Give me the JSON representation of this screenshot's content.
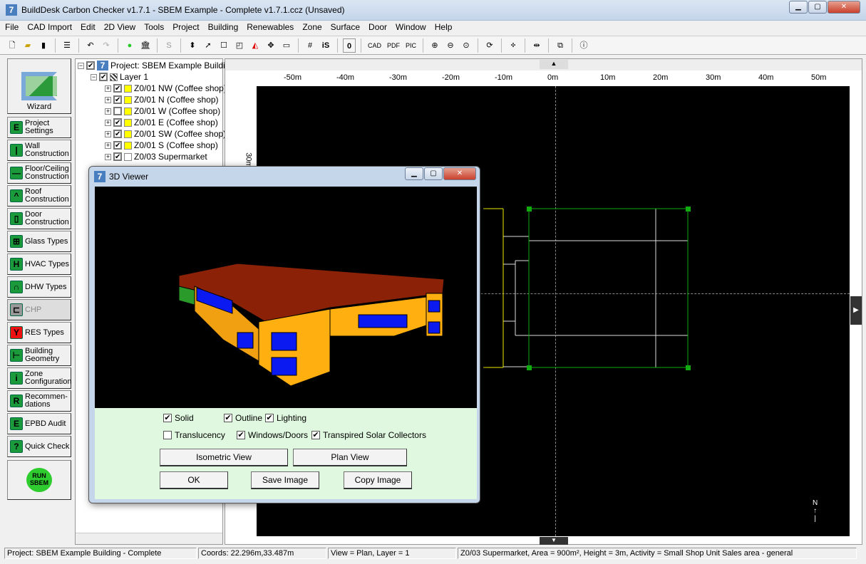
{
  "window": {
    "title": "BuildDesk Carbon Checker v1.7.1 - SBEM Example - Complete v1.7.1.ccz (Unsaved)",
    "app_icon": "7"
  },
  "menu": [
    "File",
    "CAD Import",
    "Edit",
    "2D View",
    "Tools",
    "Project",
    "Building",
    "Renewables",
    "Zone",
    "Surface",
    "Door",
    "Window",
    "Help"
  ],
  "toolbar": {
    "text_buttons": [
      "S",
      "iS",
      "0",
      "CAD",
      "PDF",
      "PIC"
    ]
  },
  "sidebar": {
    "wizard_label": "Wizard",
    "items": [
      {
        "label": "Project Settings",
        "icon": "E",
        "color": "#1a9a3a"
      },
      {
        "label": "Wall Construction",
        "icon": "|",
        "color": "#1a9a3a"
      },
      {
        "label": "Floor/Ceiling Construction",
        "icon": "—",
        "color": "#1a9a3a"
      },
      {
        "label": "Roof Construction",
        "icon": "^",
        "color": "#1a9a3a"
      },
      {
        "label": "Door Construction",
        "icon": "▯",
        "color": "#1a9a3a"
      },
      {
        "label": "Glass Types",
        "icon": "⊞",
        "color": "#1a9a3a"
      },
      {
        "label": "HVAC Types",
        "icon": "H",
        "color": "#1a9a3a"
      },
      {
        "label": "DHW Types",
        "icon": "∩",
        "color": "#1a9a3a"
      },
      {
        "label": "CHP",
        "icon": "⊏",
        "color": "#999999",
        "disabled": true
      },
      {
        "label": "RES Types",
        "icon": "Y",
        "color": "#ee1111"
      },
      {
        "label": "Building Geometry",
        "icon": "⊢",
        "color": "#1a9a3a"
      },
      {
        "label": "Zone Configuration",
        "icon": "i",
        "color": "#1a9a3a"
      },
      {
        "label": "Recommen-dations",
        "icon": "R",
        "color": "#1a9a3a"
      },
      {
        "label": "EPBD Audit",
        "icon": "E",
        "color": "#1a9a3a"
      },
      {
        "label": "Quick Check",
        "icon": "?",
        "color": "#1a9a3a"
      }
    ],
    "run_label": "RUN SBEM"
  },
  "tree": {
    "project": "Project: SBEM Example Building",
    "layer": "Layer 1",
    "zones": [
      {
        "label": "Z0/01 NW (Coffee shop)",
        "checked": true,
        "color": "#ffff00"
      },
      {
        "label": "Z0/01 N (Coffee shop)",
        "checked": true,
        "color": "#ffff00"
      },
      {
        "label": "Z0/01 W (Coffee shop)",
        "checked": false,
        "color": "#ffff00"
      },
      {
        "label": "Z0/01 E (Coffee shop)",
        "checked": true,
        "color": "#ffff00"
      },
      {
        "label": "Z0/01 SW (Coffee shop)",
        "checked": true,
        "color": "#ffff00"
      },
      {
        "label": "Z0/01 S (Coffee shop)",
        "checked": true,
        "color": "#ffff00"
      },
      {
        "label": "Z0/03 Supermarket",
        "checked": true,
        "color": "#ffffff"
      }
    ]
  },
  "ruler": {
    "x_labels": [
      "-50m",
      "-40m",
      "-30m",
      "-20m",
      "-10m",
      "0m",
      "10m",
      "20m",
      "30m",
      "40m",
      "50m"
    ],
    "y_label": "30m",
    "north": "N"
  },
  "viewer": {
    "title": "3D Viewer",
    "options": [
      {
        "label": "Solid",
        "checked": true
      },
      {
        "label": "Outline",
        "checked": true
      },
      {
        "label": "Lighting",
        "checked": true
      },
      {
        "label": "Translucency",
        "checked": false
      },
      {
        "label": "Windows/Doors",
        "checked": true
      },
      {
        "label": "Transpired Solar Collectors",
        "checked": true
      }
    ],
    "buttons": {
      "iso": "Isometric View",
      "plan": "Plan View",
      "ok": "OK",
      "save": "Save Image",
      "copy": "Copy Image"
    }
  },
  "status": {
    "project": "Project: SBEM Example Building - Complete",
    "coords": "Coords: 22.296m,33.487m",
    "view": "View = Plan,   Layer = 1",
    "zone": "Z0/03 Supermarket, Area = 900m², Height = 3m, Activity = Small Shop Unit Sales area - general"
  }
}
